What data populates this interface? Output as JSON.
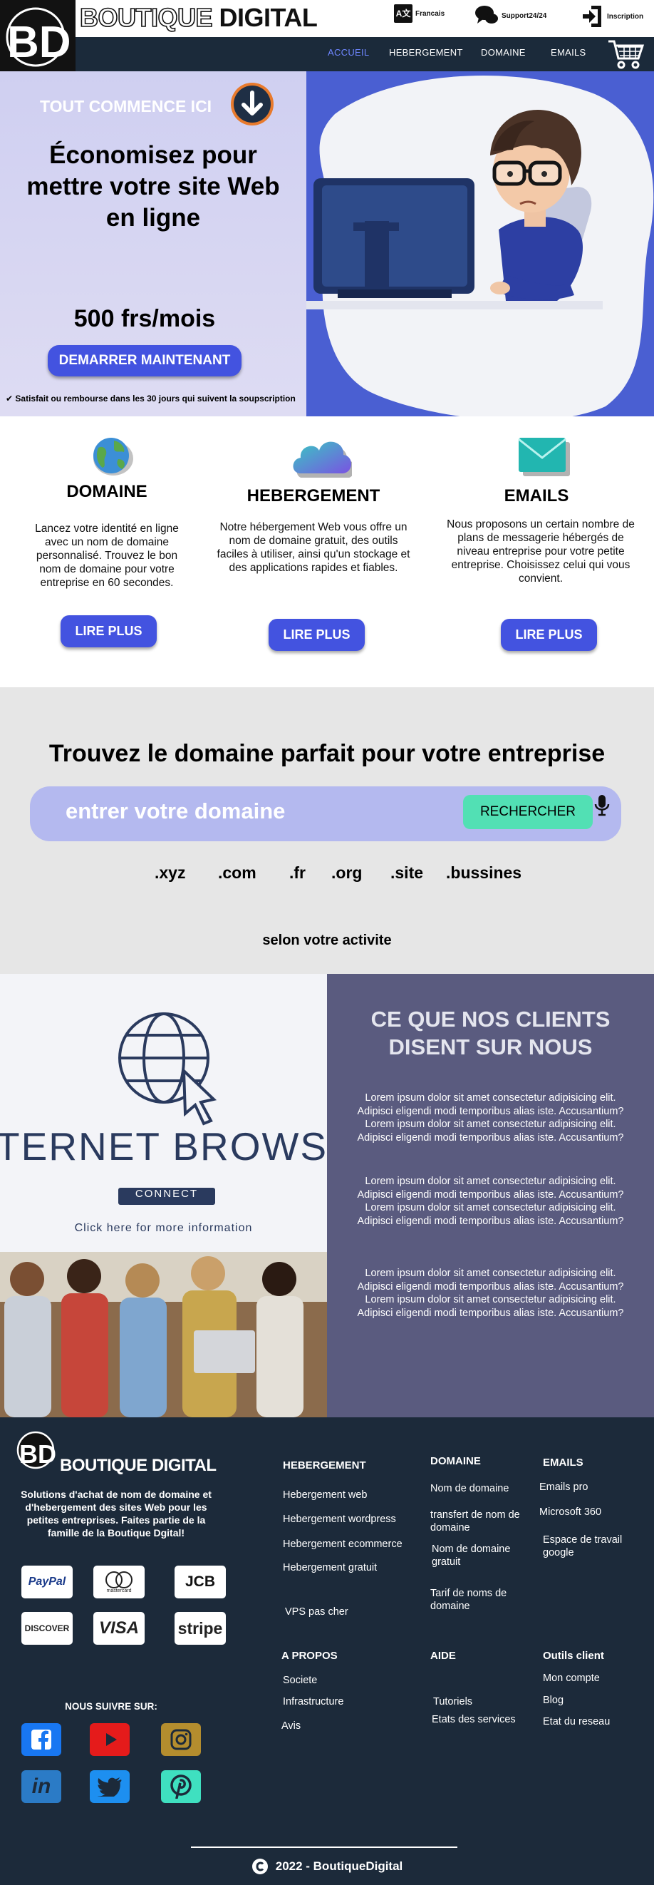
{
  "brand": {
    "logo_text": "BD",
    "name_part1": "BOUTIQUE",
    "name_part2": "DIGITAL"
  },
  "utility": {
    "language": "Francais",
    "support": "Support24/24",
    "signup": "Inscription"
  },
  "nav": {
    "items": [
      "ACCUEIL",
      "HEBERGEMENT",
      "DOMAINE",
      "EMAILS"
    ],
    "active_color": "#6e86ff"
  },
  "hero": {
    "kicker": "TOUT COMMENCE ICI",
    "headline_line1": "Économisez pour",
    "headline_line2": "mettre votre site Web",
    "headline_line3": "en ligne",
    "price": "500 frs/mois",
    "cta": "DEMARRER MAINTENANT",
    "guarantee": "Satisfait ou rembourse dans les 30 jours qui suivent la soupscription"
  },
  "services": [
    {
      "icon": "globe-icon",
      "title": "DOMAINE",
      "text": "Lancez votre identité en ligne avec un nom de domaine personnalisé. Trouvez le bon nom de domaine pour votre entreprise en 60 secondes.",
      "button": "LIRE PLUS"
    },
    {
      "icon": "cloud-icon",
      "title": "HEBERGEMENT",
      "text": "Notre hébergement Web vous offre un nom de domaine gratuit, des outils faciles à utiliser, ainsi qu'un stockage et des applications rapides et fiables.",
      "button": "LIRE PLUS"
    },
    {
      "icon": "mail-icon",
      "title": "EMAILS",
      "text": "Nous proposons un certain nombre de plans de messagerie hébergés de niveau entreprise pour votre petite entreprise. Choisissez celui qui vous convient.",
      "button": "LIRE PLUS"
    }
  ],
  "domain_search": {
    "title": "Trouvez le domaine parfait pour votre entreprise",
    "placeholder": "entrer votre domaine",
    "button": "RECHERCHER",
    "extensions": [
      ".xyz",
      ".com",
      ".fr",
      ".org",
      ".site",
      ".bussines"
    ],
    "note": "selon votre activite"
  },
  "browse_image": {
    "banner": "TERNET  BROWS",
    "connect": "CONNECT",
    "hint": "Click here for more information"
  },
  "testimonials": {
    "title_line1": "CE QUE NOS CLIENTS",
    "title_line2": "DISENT SUR NOUS",
    "blocks": [
      [
        "Lorem ipsum dolor sit amet consectetur adipisicing elit.",
        "Adipisci eligendi modi temporibus alias iste. Accusantium?",
        "Lorem ipsum dolor sit amet consectetur adipisicing elit.",
        "Adipisci eligendi modi temporibus alias iste. Accusantium?"
      ],
      [
        "Lorem ipsum dolor sit amet consectetur adipisicing elit.",
        "Adipisci eligendi modi temporibus alias iste. Accusantium?",
        "Lorem ipsum dolor sit amet consectetur adipisicing elit.",
        "Adipisci eligendi modi temporibus alias iste. Accusantium?"
      ],
      [
        "Lorem ipsum dolor sit amet consectetur adipisicing elit.",
        "Adipisci eligendi modi temporibus alias iste. Accusantium?",
        "Lorem ipsum dolor sit amet consectetur adipisicing elit.",
        "Adipisci eligendi modi temporibus alias iste. Accusantium?"
      ]
    ]
  },
  "footer": {
    "brand": "BOUTIQUE DIGITAL",
    "tagline": "Solutions d'achat de nom de domaine et d'hebergement des sites Web pour les petites entreprises. Faites partie de la famille de la Boutique Dgital!",
    "payments": [
      "PayPal",
      "mastercard",
      "JCB",
      "DISCOVER",
      "VISA",
      "stripe"
    ],
    "follow": "NOUS SUIVRE SUR:",
    "socials": [
      "facebook-icon",
      "youtube-icon",
      "instagram-icon",
      "linkedin-icon",
      "twitter-icon",
      "pinterest-icon"
    ],
    "col_hebergement": {
      "title": "HEBERGEMENT",
      "links": [
        "Hebergement web",
        "Hebergement wordpress",
        "Hebergement ecommerce",
        "Hebergement gratuit",
        "VPS pas cher"
      ]
    },
    "col_domaine": {
      "title": "DOMAINE",
      "links": [
        "Nom de domaine",
        "transfert de nom de domaine",
        "Nom de domaine gratuit",
        "Tarif de noms de domaine"
      ]
    },
    "col_emails": {
      "title": "EMAILS",
      "links": [
        "Emails pro",
        "Microsoft 360",
        "Espace de travail google"
      ]
    },
    "col_apropos": {
      "title": "A PROPOS",
      "links": [
        "Societe",
        "Infrastructure",
        "Avis"
      ]
    },
    "col_aide": {
      "title": "AIDE",
      "links": [
        "Tutoriels",
        "Etats des services"
      ]
    },
    "col_outils": {
      "title": "Outils client",
      "links": [
        "Mon compte",
        "Blog",
        "Etat du reseau"
      ]
    },
    "copyright": "2022 - BoutiqueDigital"
  }
}
